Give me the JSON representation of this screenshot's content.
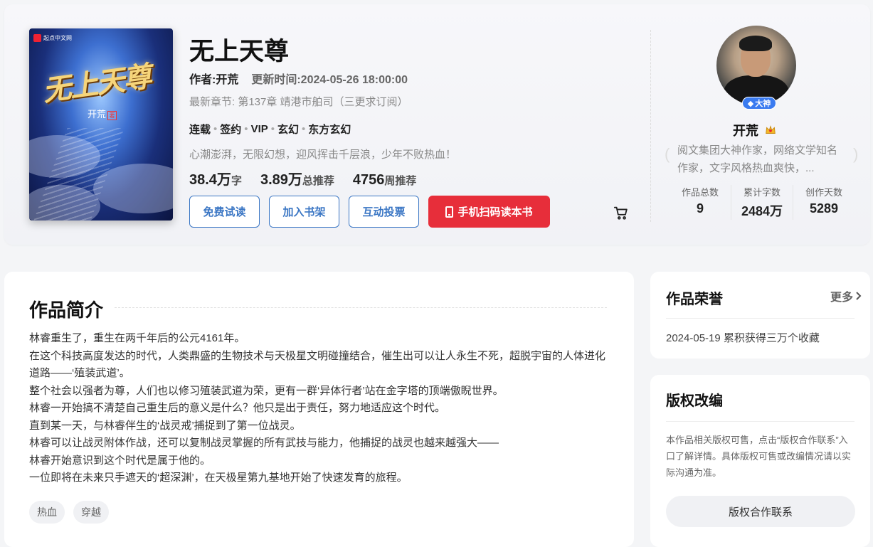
{
  "book": {
    "cover_publisher": "起点中文网",
    "cover_title": "无上天尊",
    "cover_author": "开荒",
    "cover_seal": "著",
    "title": "无上天尊",
    "author_label": "作者:开荒",
    "update_label": "更新时间:2024-05-26 18:00:00",
    "latest_chapter": "最新章节: 第137章 靖港市舶司（三更求订阅）",
    "tags": [
      "连载",
      "签约",
      "VIP",
      "玄幻",
      "东方玄幻"
    ],
    "tag_separator": "•",
    "tagline": "心潮澎湃，无限幻想，迎风挥击千层浪，少年不败热血！",
    "stats": [
      {
        "num": "38.4万",
        "unit": "字"
      },
      {
        "num": "3.89万",
        "unit": "总推荐"
      },
      {
        "num": "4756",
        "unit": "周推荐"
      }
    ],
    "buttons": {
      "free_read": "免费试读",
      "add_shelf": "加入书架",
      "vote": "互动投票",
      "mobile_read": "手机扫码读本书"
    }
  },
  "author": {
    "badge": "大神",
    "name": "开荒",
    "description": "阅文集团大神作家，网络文学知名作家，文字风格热血爽快，...",
    "stats": [
      {
        "label": "作品总数",
        "value": "9"
      },
      {
        "label": "累计字数",
        "value": "2484万"
      },
      {
        "label": "创作天数",
        "value": "5289"
      }
    ]
  },
  "synopsis": {
    "title": "作品简介",
    "paragraphs": [
      "林睿重生了，重生在两千年后的公元4161年。",
      "在这个科技高度发达的时代，人类鼎盛的生物技术与天极星文明碰撞结合，催生出可以让人永生不死，超脱宇宙的人体进化道路——‘殖装武道’。",
      "整个社会以强者为尊，人们也以修习殖装武道为荣，更有一群‘异体行者’站在金字塔的顶端傲睨世界。",
      "林睿一开始搞不清楚自己重生后的意义是什么？他只是出于责任，努力地适应这个时代。",
      "直到某一天，与林睿伴生的‘战灵戒’捕捉到了第一位战灵。",
      "林睿可以让战灵附体作战，还可以复制战灵掌握的所有武技与能力，他捕捉的战灵也越来越强大——",
      "林睿开始意识到这个时代是属于他的。",
      "一位即将在未来只手遮天的‘超深渊’，在天极星第九基地开始了快速发育的旅程。"
    ],
    "tags": [
      "热血",
      "穿越"
    ]
  },
  "honors": {
    "title": "作品荣誉",
    "more": "更多",
    "items": [
      "2024-05-19 累积获得三万个收藏"
    ]
  },
  "copyright": {
    "title": "版权改编",
    "description": "本作品相关版权可售，点击“版权合作联系”入口了解详情。具体版权可售或改编情况请以实际沟通为准。",
    "button": "版权合作联系"
  },
  "colors": {
    "accent_blue": "#3a76c4",
    "cta_red": "#e72e3a",
    "badge_blue": "#3a7bf0"
  }
}
